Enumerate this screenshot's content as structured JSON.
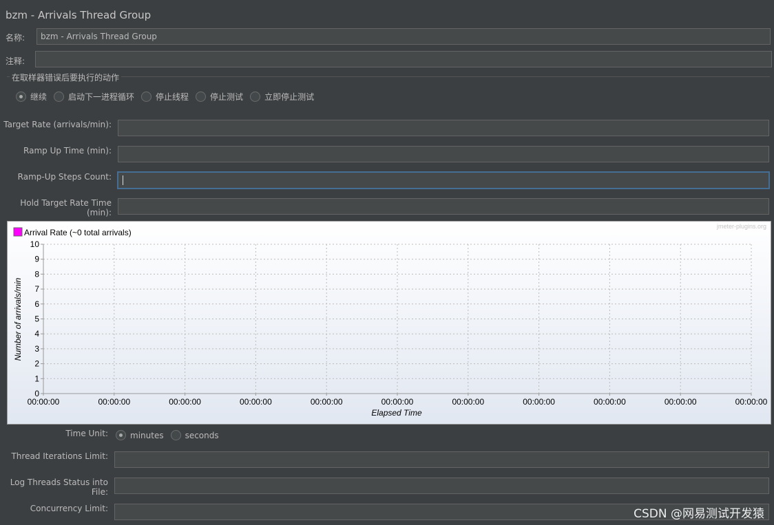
{
  "title": "bzm - Arrivals Thread Group",
  "name": {
    "label": "名称:",
    "value": "bzm - Arrivals Thread Group"
  },
  "comment": {
    "label": "注释:",
    "value": ""
  },
  "on_error": {
    "legend": "在取样器错误后要执行的动作",
    "options": [
      "继续",
      "启动下一进程循环",
      "停止线程",
      "停止测试",
      "立即停止测试"
    ],
    "selected": 0
  },
  "fields": [
    {
      "label": "Target Rate (arrivals/min):",
      "value": ""
    },
    {
      "label": "Ramp Up Time (min):",
      "value": ""
    },
    {
      "label": "Ramp-Up Steps Count:",
      "value": "",
      "focused": true
    },
    {
      "label": "Hold Target Rate Time (min):",
      "value": ""
    }
  ],
  "chart_data": {
    "type": "line",
    "legend": "Arrival Rate (~0 total arrivals)",
    "series": [
      {
        "name": "Arrival Rate (~0 total arrivals)",
        "color": "#ff00ff",
        "values": []
      }
    ],
    "watermark": "jmeter-plugins.org",
    "xlabel": "Elapsed Time",
    "ylabel": "Number of arrivals/min",
    "ylim": [
      0,
      10
    ],
    "yticks": [
      0,
      1,
      2,
      3,
      4,
      5,
      6,
      7,
      8,
      9,
      10
    ],
    "xticks": [
      "00:00:00",
      "00:00:00",
      "00:00:00",
      "00:00:00",
      "00:00:00",
      "00:00:00",
      "00:00:00",
      "00:00:00",
      "00:00:00",
      "00:00:00",
      "00:00:00"
    ],
    "grid": true,
    "legend_position": "top-left"
  },
  "time_unit": {
    "label": "Time Unit:",
    "options": [
      "minutes",
      "seconds"
    ],
    "selected": 0
  },
  "lower_fields": [
    {
      "label": "Thread Iterations Limit:",
      "value": ""
    },
    {
      "label": "Log Threads Status into File:",
      "value": ""
    },
    {
      "label": "Concurrency Limit:",
      "value": ""
    }
  ],
  "watermark": "CSDN @网易测试开发猿"
}
